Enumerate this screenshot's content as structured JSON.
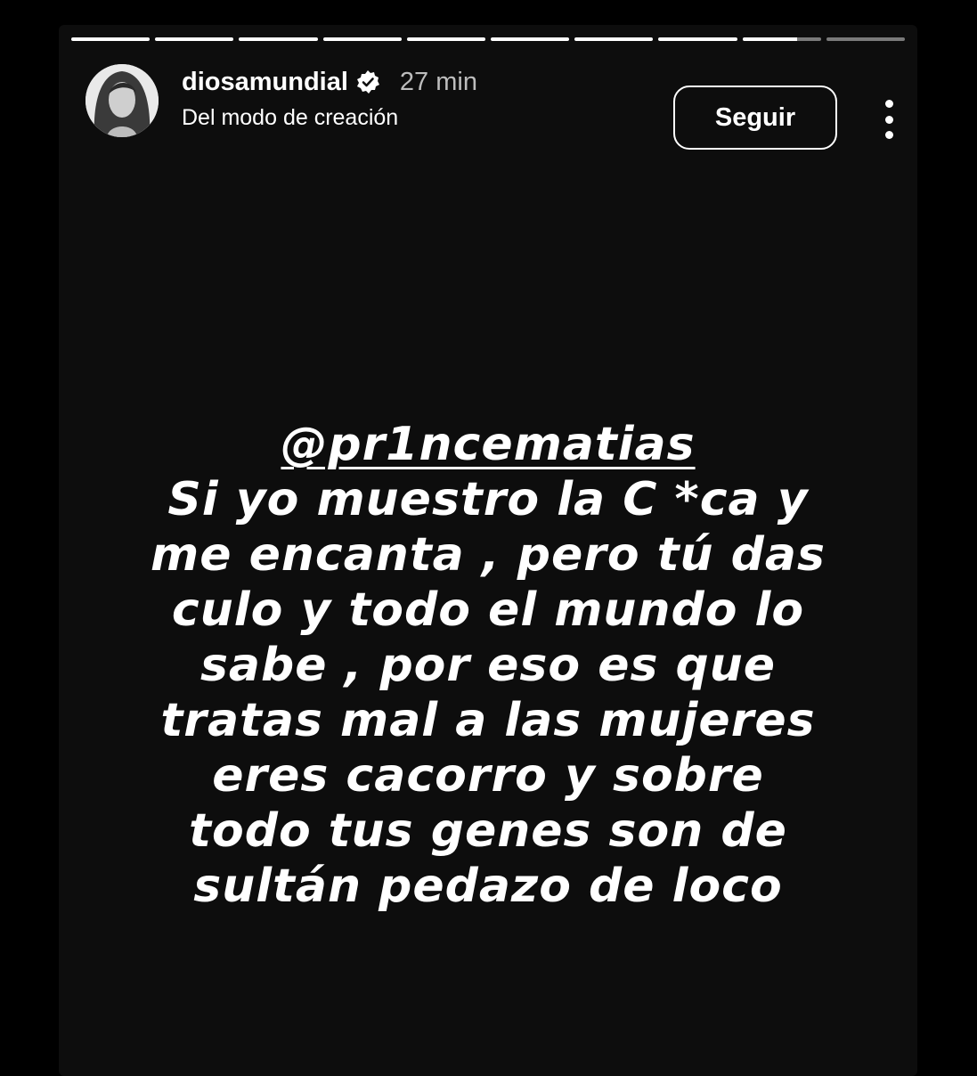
{
  "story": {
    "progress": {
      "segments": [
        1,
        1,
        1,
        1,
        1,
        1,
        1,
        1,
        0.7,
        0
      ]
    },
    "header": {
      "username": "diosamundial",
      "time": "27 min",
      "subtitle": "Del modo de creación",
      "follow_label": "Seguir"
    },
    "message": {
      "mention": "@pr1ncematias",
      "lines": [
        "Si yo muestro la C *ca y",
        "me encanta , pero tú das",
        "culo y todo el mundo lo",
        "sabe , por eso  es que",
        "tratas mal a las mujeres",
        "eres cacorro y sobre",
        "todo tus genes son de",
        "sultán pedazo de loco"
      ]
    },
    "colors": {
      "background": "#0d0d0d",
      "text": "#ffffff",
      "time": "#bdbdbd"
    }
  }
}
